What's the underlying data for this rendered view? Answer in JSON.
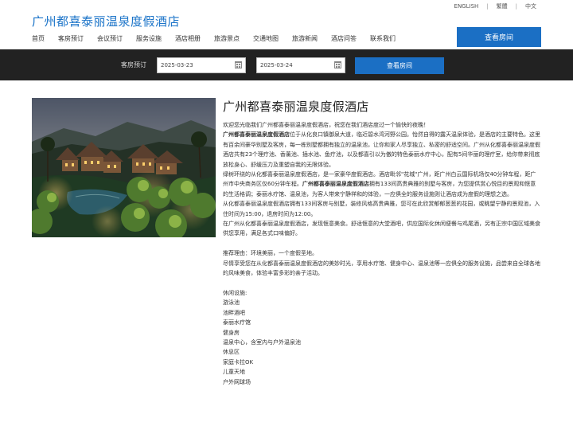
{
  "lang": {
    "english": "ENGLISH",
    "traditional": "繁體",
    "chinese": "中文"
  },
  "site_title": "广州都喜泰丽温泉度假酒店",
  "nav": [
    "首页",
    "客房预订",
    "会议预订",
    "服务设施",
    "酒店相册",
    "旅游景点",
    "交通地图",
    "旅游新闻",
    "酒店问答",
    "联系我们"
  ],
  "header_button": "查看房间",
  "booking": {
    "label": "客房预订",
    "checkin": "2025-03-23",
    "checkout": "2025-03-24",
    "button": "查看房间"
  },
  "article": {
    "title": "广州都喜泰丽温泉度假酒店",
    "p_welcome": "欢迎您光临我们广州都喜泰丽温泉度假酒店，祝您在我们酒店度过一个愉快的夜晚！",
    "p1_bold": "广州都喜泰丽温泉度假酒店",
    "p1_rest": "位于从化良口镇御泉大道，临近碧水湾河野公园。怡然自得的露天温泉体验，是酒店的主要特色。这里有百余间豪华别墅及客房，每一栋别墅都拥有独立的温泉池，让你和家人尽享独立、私密的舒适空间。广州从化都喜泰丽温泉度假酒店共有23个理疗池、香薰池、插水池、鱼疗池，以及都喜引以为傲的特色泰丽水疗中心，配有5间华丽的理疗室，给你带来彻底放松身心、舒缓压力及重塑自我的无限体验。",
    "p2_a": "绿树环绕的从化都喜泰丽温泉度假酒店，是一家豪华度假酒店。酒店毗邻\"花城\"广州，距广州白云国际机场仅40分钟车程，距广州市中央商务区仅60分钟车程。",
    "p2_bold": "广州都喜泰丽温泉度假酒店",
    "p2_b": "拥有133间高贵典雅的别墅与客房，为您提供赏心悦目的景观和惬意的生活格调；泰丽水疗馆、温泉池，为客人带来宁静祥和的体验，一应俱全的服务设施则让酒店成为度假的理想之选。",
    "p3": "从化都喜泰丽温泉度假酒店拥有133间客房与别墅，装修风格高贵典雅，您可在此欣赏郁郁葱葱的花园，或眺望宁静的景观池，入住时间为15:00，退房时间为12:00。",
    "p4": "在广州从化都喜泰丽温泉度假酒店，发现惬意美食。舒适惬意的大堂酒吧，供应国际化休闲便餐与鸡尾酒，另有正宗中国区域美食供您享用，满足各式口味偏好。",
    "p5": "推荐理由：环境美丽，一个度假圣地。",
    "p6": "尽情享受您在从化都喜泰丽温泉度假酒店的美妙时光，享用水疗馆、健身中心、温泉池等一应俱全的服务设施，品尝来自全球各地的风味美食，体验丰富多彩的亲子活动。",
    "facilities_title": "休闲设施:",
    "facilities": [
      "游泳池",
      "池畔酒吧",
      "泰丽水疗馆",
      "健身房",
      "温泉中心，含室内与户外温泉池",
      "休息区",
      "家庭卡拉OK",
      "儿童天地",
      "户外网球场"
    ]
  }
}
